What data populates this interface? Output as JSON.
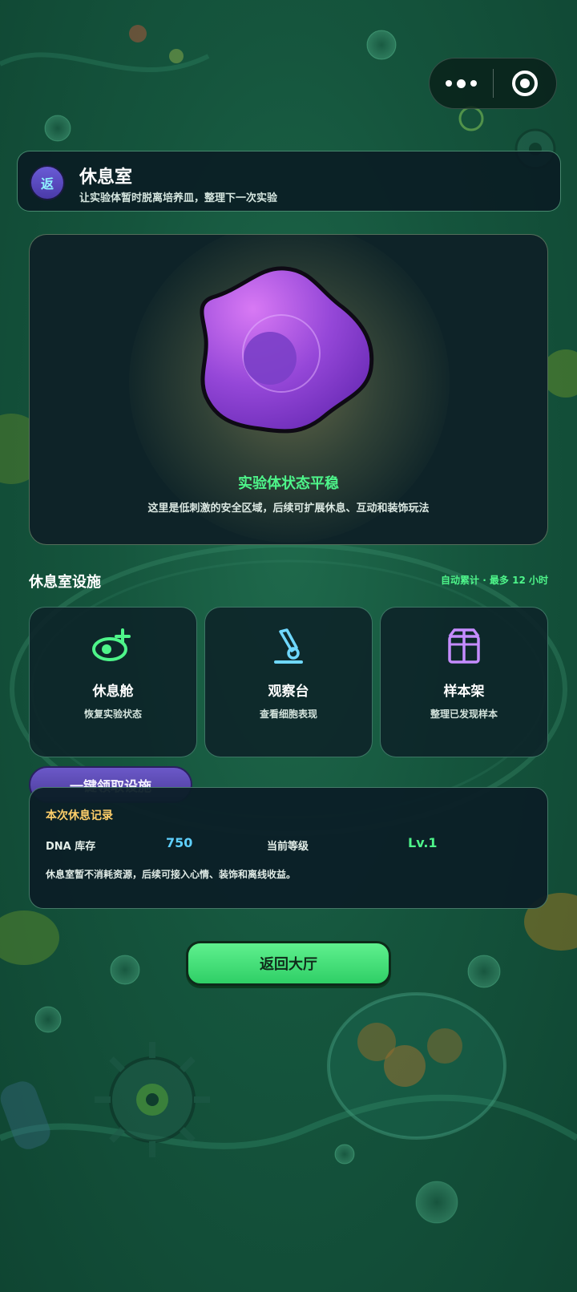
{
  "capsule": {
    "more_icon": "more-dots-icon",
    "close_icon": "target-circle-icon"
  },
  "header": {
    "back_label": "返",
    "title": "休息室",
    "subtitle": "让实验体暂时脱离培养皿，整理下一次实验"
  },
  "hero": {
    "status": "实验体状态平稳",
    "description": "这里是低刺激的安全区域，后续可扩展休息、互动和装饰玩法",
    "cell_color": "#a555e8"
  },
  "facilities": {
    "title": "休息室设施",
    "note": "自动累计 · 最多 12 小时",
    "items": [
      {
        "name": "休息舱",
        "desc": "恢复实验状态",
        "icon": "capsule-pod-icon",
        "color": "#4ef58a"
      },
      {
        "name": "观察台",
        "desc": "查看细胞表现",
        "icon": "microscope-icon",
        "color": "#6fd8ff"
      },
      {
        "name": "样本架",
        "desc": "整理已发现样本",
        "icon": "sample-box-icon",
        "color": "#c58cff"
      }
    ]
  },
  "claim_button": {
    "label": "一键领取设施"
  },
  "record": {
    "title": "本次休息记录",
    "dna_label": "DNA 库存",
    "dna_value": "750",
    "level_label": "当前等级",
    "level_value": "Lv.1",
    "note": "休息室暂不消耗资源，后续可接入心情、装饰和离线收益。"
  },
  "return_button": {
    "label": "返回大厅"
  }
}
